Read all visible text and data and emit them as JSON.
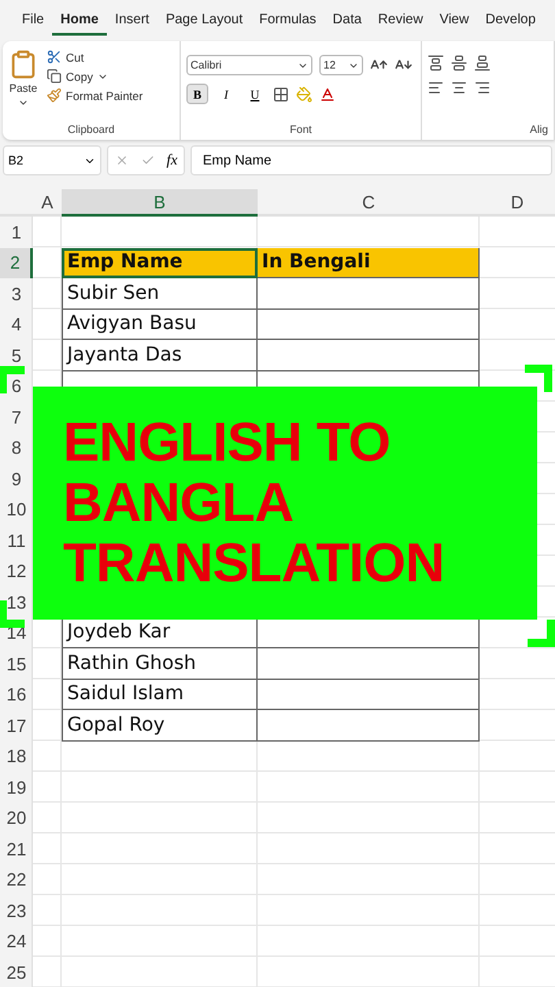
{
  "menu_tabs": [
    {
      "label": "File",
      "selected": false
    },
    {
      "label": "Home",
      "selected": true
    },
    {
      "label": "Insert",
      "selected": false
    },
    {
      "label": "Page Layout",
      "selected": false
    },
    {
      "label": "Formulas",
      "selected": false
    },
    {
      "label": "Data",
      "selected": false
    },
    {
      "label": "Review",
      "selected": false
    },
    {
      "label": "View",
      "selected": false
    },
    {
      "label": "Develop",
      "selected": false
    }
  ],
  "ribbon": {
    "clipboard": {
      "paste": "Paste",
      "cut": "Cut",
      "copy": "Copy",
      "format_painter": "Format Painter",
      "label": "Clipboard"
    },
    "font": {
      "name": "Calibri",
      "size": "12",
      "bold": "B",
      "italic": "I",
      "underline": "U",
      "bold_on": true,
      "label": "Font"
    },
    "alignment": {
      "label": "Alig"
    }
  },
  "formula_bar": {
    "name_box": "B2",
    "fx": "fx",
    "value": "Emp Name"
  },
  "columns": [
    {
      "label": "A",
      "selected": false
    },
    {
      "label": "B",
      "selected": true
    },
    {
      "label": "C",
      "selected": false
    },
    {
      "label": "D",
      "selected": false
    }
  ],
  "rows": [
    {
      "label": "1",
      "kind": "blank",
      "selected": false
    },
    {
      "label": "2",
      "kind": "header",
      "selected": true,
      "name": "Emp Name",
      "bengali": "In Bengali"
    },
    {
      "label": "3",
      "kind": "data",
      "selected": false,
      "name": "Subir Sen"
    },
    {
      "label": "4",
      "kind": "data",
      "selected": false,
      "name": "Avigyan Basu"
    },
    {
      "label": "5",
      "kind": "data",
      "selected": false,
      "name": "Jayanta Das"
    },
    {
      "label": "6",
      "kind": "data",
      "selected": false
    },
    {
      "label": "7",
      "kind": "covered",
      "selected": false
    },
    {
      "label": "8",
      "kind": "covered",
      "selected": false
    },
    {
      "label": "9",
      "kind": "covered",
      "selected": false
    },
    {
      "label": "10",
      "kind": "covered",
      "selected": false
    },
    {
      "label": "11",
      "kind": "covered",
      "selected": false
    },
    {
      "label": "12",
      "kind": "covered",
      "selected": false
    },
    {
      "label": "13",
      "kind": "covered",
      "selected": false
    },
    {
      "label": "14",
      "kind": "data",
      "selected": false,
      "name": "Joydeb Kar"
    },
    {
      "label": "15",
      "kind": "data",
      "selected": false,
      "name": "Rathin Ghosh"
    },
    {
      "label": "16",
      "kind": "data",
      "selected": false,
      "name": "Saidul Islam"
    },
    {
      "label": "17",
      "kind": "data",
      "selected": false,
      "name": "Gopal Roy"
    },
    {
      "label": "18",
      "kind": "blank",
      "selected": false
    },
    {
      "label": "19",
      "kind": "blank",
      "selected": false
    },
    {
      "label": "20",
      "kind": "blank",
      "selected": false
    },
    {
      "label": "21",
      "kind": "blank",
      "selected": false
    },
    {
      "label": "22",
      "kind": "blank",
      "selected": false
    },
    {
      "label": "23",
      "kind": "blank",
      "selected": false
    },
    {
      "label": "24",
      "kind": "blank",
      "selected": false
    },
    {
      "label": "25",
      "kind": "blank",
      "selected": false
    }
  ],
  "banner": {
    "lines": [
      "ENGLISH TO",
      "BANGLA",
      "TRANSLATION"
    ]
  }
}
